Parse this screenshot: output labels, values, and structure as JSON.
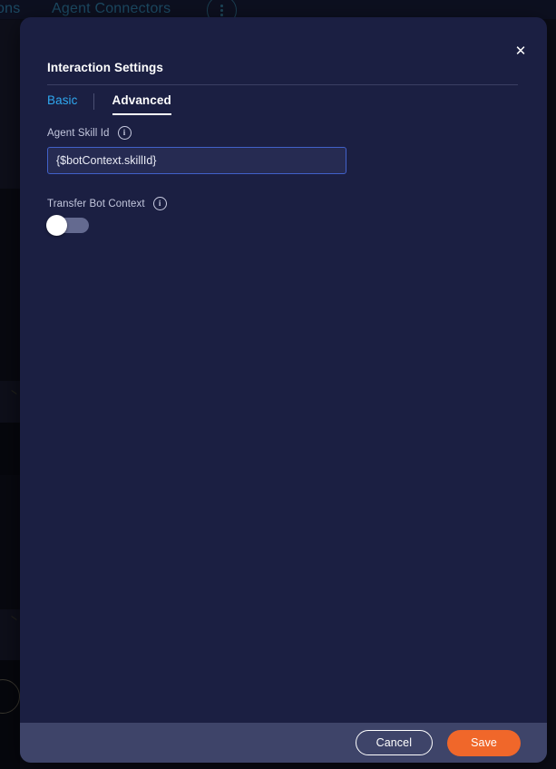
{
  "background": {
    "nav_items": [
      {
        "label": "ons"
      },
      {
        "label": "Agent Connectors"
      }
    ],
    "kebab_icon": "more-vertical-icon"
  },
  "modal": {
    "title": "Interaction Settings",
    "close_icon": "✕",
    "tabs": [
      {
        "id": "basic",
        "label": "Basic",
        "active": false
      },
      {
        "id": "advanced",
        "label": "Advanced",
        "active": true
      }
    ],
    "fields": {
      "agent_skill_id": {
        "label": "Agent Skill Id",
        "info_icon": "i",
        "value": "{$botContext.skillId}",
        "placeholder": ""
      },
      "transfer_bot_context": {
        "label": "Transfer Bot Context",
        "info_icon": "i",
        "enabled": false
      }
    },
    "footer": {
      "cancel_label": "Cancel",
      "save_label": "Save"
    }
  },
  "colors": {
    "modal_bg": "#1b1f42",
    "footer_bg": "#3e4469",
    "accent_save": "#f0672a",
    "tab_inactive": "#2fa8f0",
    "input_border": "#4161c9",
    "page_bg": "#0b0c16"
  }
}
